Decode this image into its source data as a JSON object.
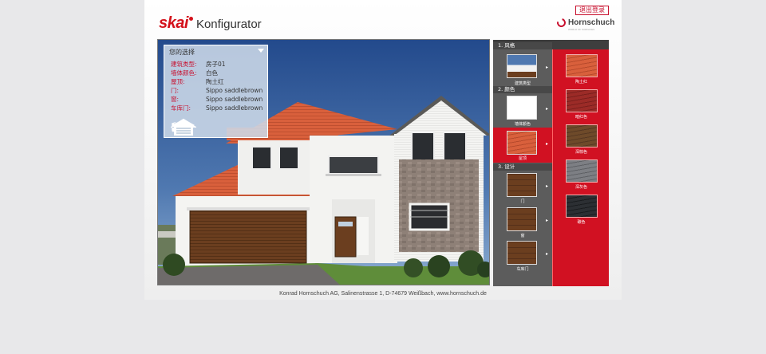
{
  "header": {
    "brand_name": "skai",
    "app_name": "Konfigurator",
    "logout_label": "退出登录",
    "company_name": "Hornschuch",
    "company_tagline": "WORLD OF SURFACES"
  },
  "info_panel": {
    "title": "您的选择",
    "rows": [
      {
        "key": "建筑类型:",
        "value": "房子01"
      },
      {
        "key": "墙体颜色:",
        "value": "白色"
      },
      {
        "key": "屋顶:",
        "value": "陶土红"
      },
      {
        "key": "门:",
        "value": "Sippo saddlebrown"
      },
      {
        "key": "窗:",
        "value": "Sippo saddlebrown"
      },
      {
        "key": "车库门:",
        "value": "Sippo saddlebrown"
      }
    ],
    "icons": [
      "garage-house-icon",
      "door-icon",
      "window-icon",
      "garage-door-icon"
    ]
  },
  "sidebar": {
    "sections": [
      {
        "heading": "1. 风格",
        "items": [
          {
            "label": "建筑类型"
          }
        ]
      },
      {
        "heading": "2. 颜色",
        "items": [
          {
            "label": "墙体颜色"
          },
          {
            "label": "屋顶"
          }
        ]
      },
      {
        "heading": "3. 设计",
        "items": [
          {
            "label": "门"
          },
          {
            "label": "窗"
          },
          {
            "label": "车库门"
          }
        ]
      }
    ],
    "roof_options": [
      {
        "label": "陶土红",
        "color": "#d9603c"
      },
      {
        "label": "暗红色",
        "color": "#9c2b27"
      },
      {
        "label": "深棕色",
        "color": "#6e4a2a"
      },
      {
        "label": "深灰色",
        "color": "#7d7f84"
      },
      {
        "label": "碳色",
        "color": "#2c2f33"
      }
    ]
  },
  "footer": {
    "text": "Konrad Hornschuch AG, Salinenstrasse 1, D-74679 Weißbach, www.hornschuch.de"
  },
  "colors": {
    "accent": "#d11122",
    "sidebar_dark": "#5c5c5c",
    "roof": "#d9603c",
    "wood": "#6b3e1f"
  }
}
